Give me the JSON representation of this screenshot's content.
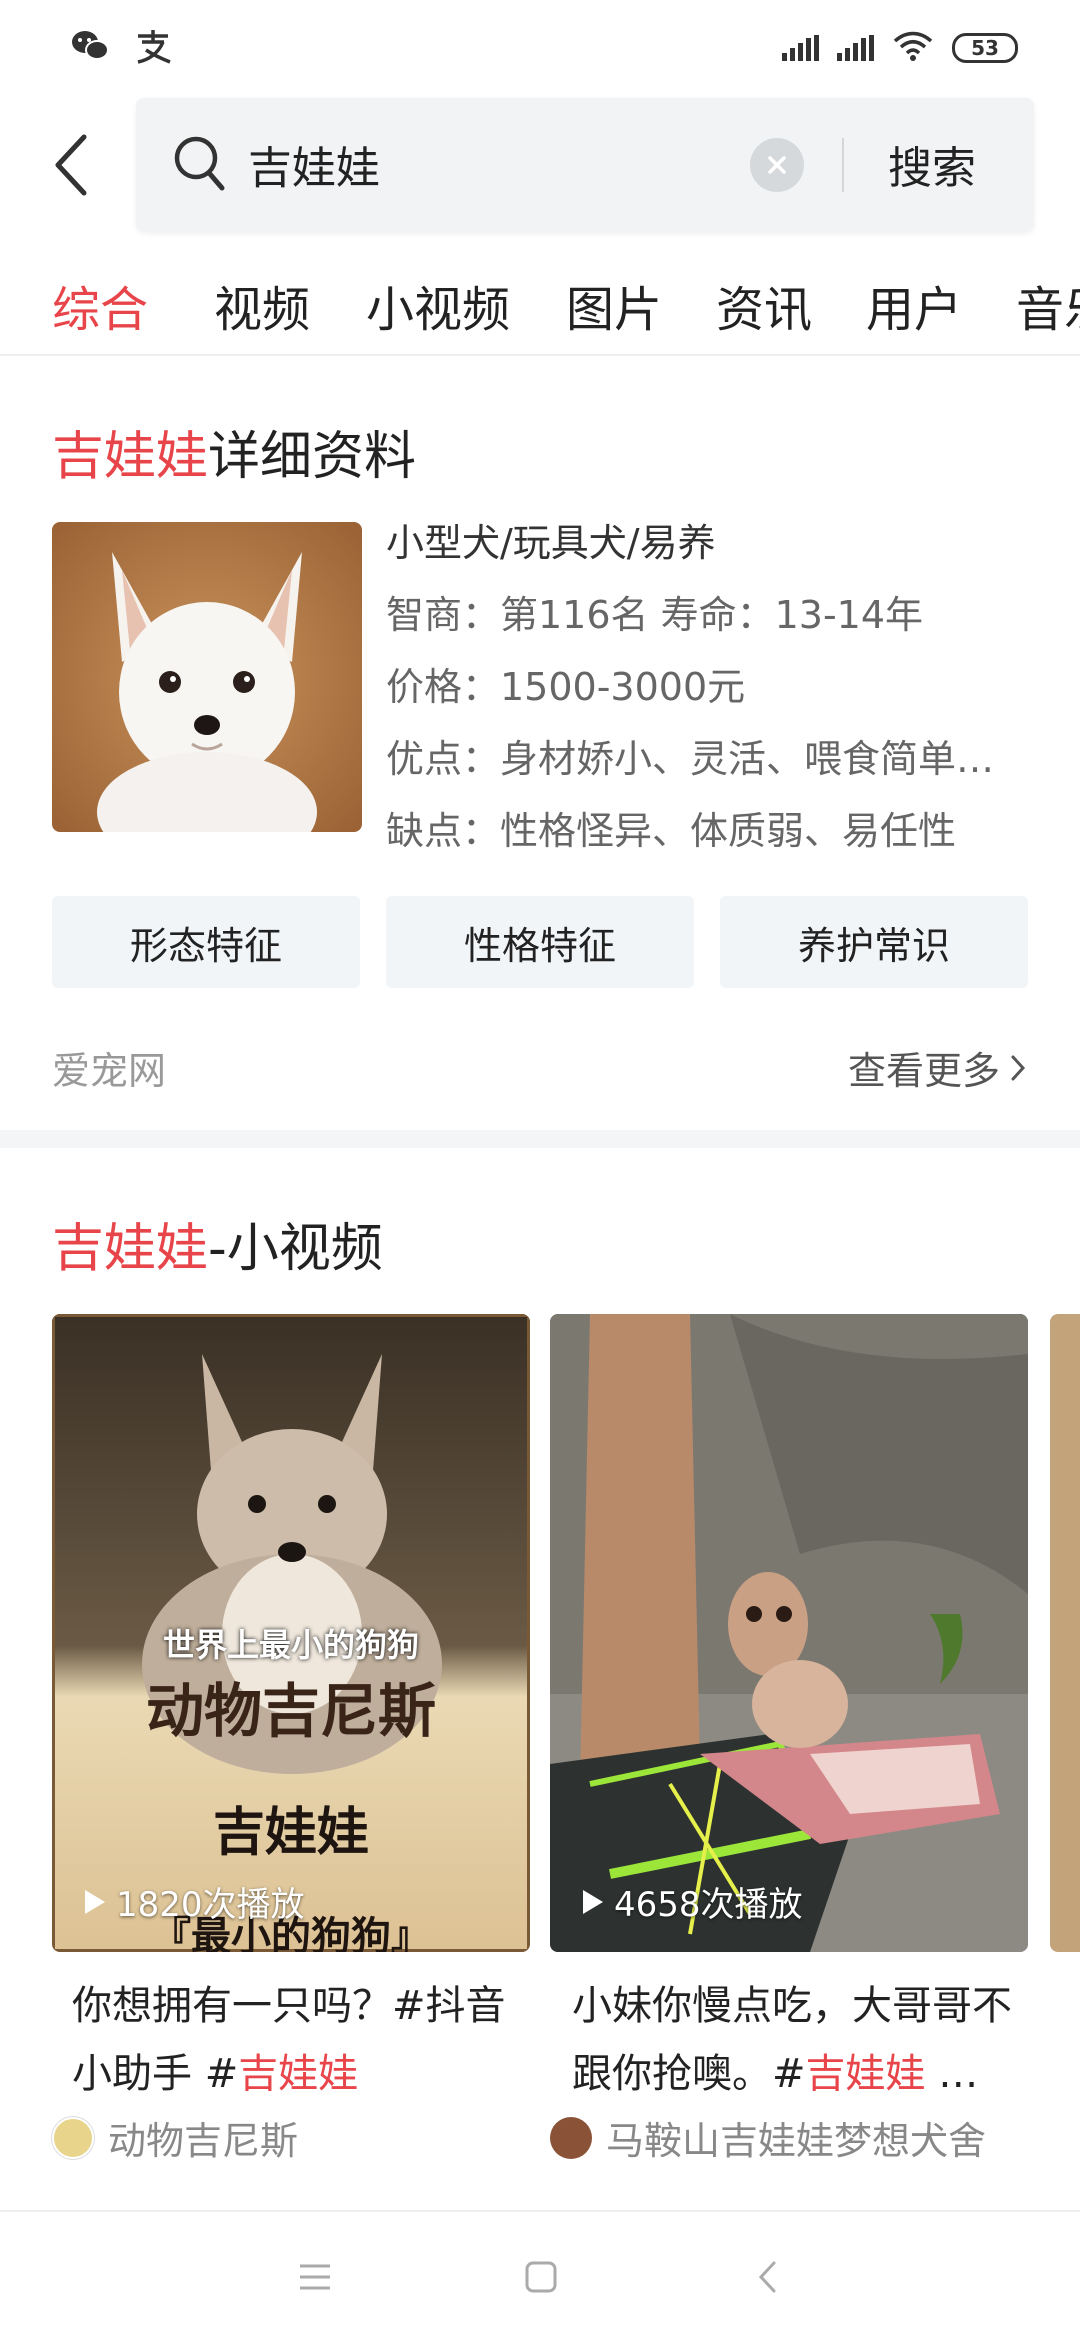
{
  "status_bar": {
    "battery": "53",
    "left_icons": [
      "wechat-icon",
      "alipay-icon"
    ],
    "right_icons": [
      "signal-icon",
      "signal-icon",
      "wifi-icon",
      "battery-icon"
    ]
  },
  "search": {
    "query": "吉娃娃",
    "button_label": "搜索"
  },
  "tabs": [
    {
      "label": "综合",
      "active": true
    },
    {
      "label": "视频"
    },
    {
      "label": "小视频"
    },
    {
      "label": "图片"
    },
    {
      "label": "资讯"
    },
    {
      "label": "用户"
    },
    {
      "label": "音乐"
    }
  ],
  "profile_card": {
    "title_highlight": "吉娃娃",
    "title_rest": "详细资料",
    "info": [
      "小型犬/玩具犬/易养",
      "智商：第116名 寿命：13-14年",
      "价格：1500-3000元",
      "优点：身材娇小、灵活、喂食简单、容易训练",
      "缺点：性格怪异、体质弱、易任性"
    ],
    "buttons": [
      "形态特征",
      "性格特征",
      "养护常识"
    ],
    "source": "爱宠网",
    "more": "查看更多"
  },
  "video_section": {
    "title_highlight": "吉娃娃",
    "title_rest": "-小视频",
    "videos": [
      {
        "overlay_line1": "世界上最小的狗狗",
        "overlay_line2": "动物吉尼斯",
        "overlay_line3": "吉娃娃",
        "overlay_line4": "『最小的狗狗』",
        "plays": "1820次播放",
        "title_part1": "你想拥有一只吗？#抖音小助手 #",
        "title_highlight": "吉娃娃",
        "title_part2": "",
        "author": "动物吉尼斯"
      },
      {
        "plays": "4658次播放",
        "title_part1": "小妹你慢点吃，大哥哥不跟你抢噢。#",
        "title_highlight": "吉娃娃",
        "title_part2": " …",
        "author": "马鞍山吉娃娃梦想犬舍"
      }
    ]
  },
  "colors": {
    "accent": "#e8454a",
    "text": "#222222",
    "muted": "#999999",
    "pill_bg": "#f2f5f8"
  }
}
